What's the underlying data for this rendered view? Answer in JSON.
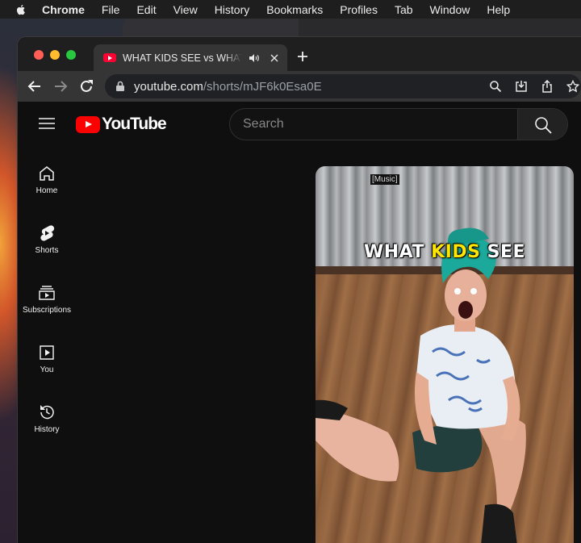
{
  "menubar": {
    "items": [
      "Chrome",
      "File",
      "Edit",
      "View",
      "History",
      "Bookmarks",
      "Profiles",
      "Tab",
      "Window",
      "Help"
    ]
  },
  "browser": {
    "tab_title": "WHAT KIDS SEE vs WHAT PARENTS SEE",
    "url_host": "youtube.com",
    "url_path": "/shorts/mJF6k0Esa0E"
  },
  "youtube": {
    "logo_text": "YouTube",
    "search_placeholder": "Search",
    "sidebar": [
      {
        "label": "Home",
        "icon": "home-icon"
      },
      {
        "label": "Shorts",
        "icon": "shorts-icon"
      },
      {
        "label": "Subscriptions",
        "icon": "subscriptions-icon"
      },
      {
        "label": "You",
        "icon": "you-icon"
      },
      {
        "label": "History",
        "icon": "history-icon"
      }
    ],
    "short": {
      "music_tag": "[Music]",
      "caption_pre": "WHAT ",
      "caption_hl": "KIDS",
      "caption_post": " SEE"
    }
  },
  "colors": {
    "youtube_red": "#ff0000",
    "caption_highlight": "#ffe600"
  }
}
